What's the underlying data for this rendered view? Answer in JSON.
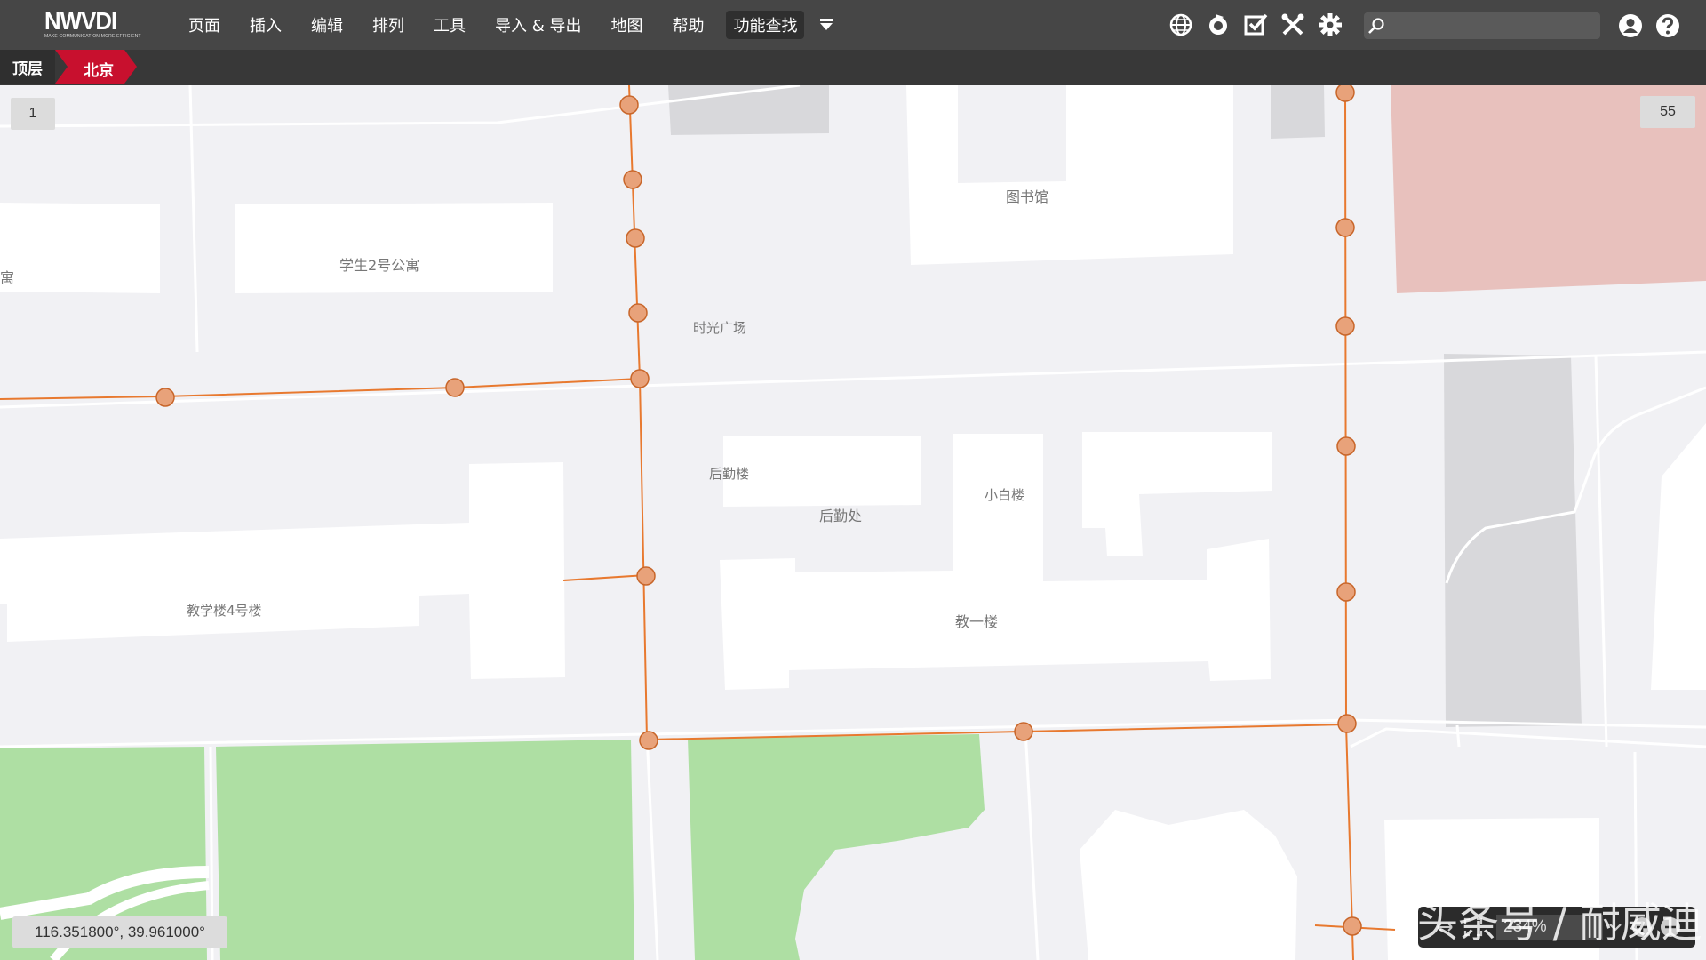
{
  "app": {
    "logo": "NWVDI",
    "logo_tagline": "MAKE COMMUNICATION MORE EFFICIENT"
  },
  "menu": [
    {
      "label": "页面"
    },
    {
      "label": "插入"
    },
    {
      "label": "编辑"
    },
    {
      "label": "排列"
    },
    {
      "label": "工具"
    },
    {
      "label": "导入 & 导出"
    },
    {
      "label": "地图"
    },
    {
      "label": "帮助"
    },
    {
      "label": "功能查找"
    }
  ],
  "toolbar_icons": [
    "globe-icon",
    "refresh-icon",
    "checkbox-edit-icon",
    "tools-icon",
    "gear-icon"
  ],
  "search": {
    "placeholder": "",
    "value": ""
  },
  "breadcrumb": [
    {
      "label": "顶层"
    },
    {
      "label": "北京"
    }
  ],
  "map": {
    "page_left": "1",
    "page_right": "55",
    "labels": {
      "library": "图书馆",
      "dorm2": "学生2号公寓",
      "dorm_partial": "寓",
      "plaza": "时光广场",
      "logistics_bldg": "后勤楼",
      "logistics_office": "后勤处",
      "white_bldg": "小白楼",
      "teaching4": "教学楼4号楼",
      "teaching1": "教一楼"
    },
    "coordinates": "116.351800°, 39.961000°",
    "zoom": "234%",
    "watermark": "头条号 / 耐威迪"
  },
  "colors": {
    "topbar": "#464646",
    "breadcrumb_active": "#c8102e",
    "route": "#e8792f",
    "park": "#aedfa3",
    "highlight_zone": "#e8c1bd"
  }
}
